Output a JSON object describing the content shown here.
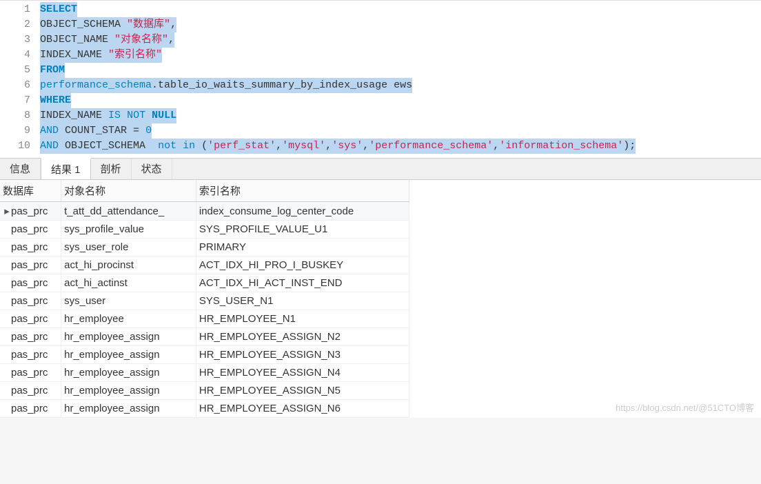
{
  "editor": {
    "lines": [
      1,
      2,
      3,
      4,
      5,
      6,
      7,
      8,
      9,
      10
    ],
    "line1": {
      "select": "SELECT"
    },
    "line2": {
      "obj_schema": "OBJECT_SCHEMA",
      "alias": "\"数据库\"",
      "comma": ","
    },
    "line3": {
      "obj_name": "OBJECT_NAME",
      "alias": "\"对象名称\"",
      "comma": ","
    },
    "line4": {
      "idx_name": "INDEX_NAME",
      "alias": "\"索引名称\""
    },
    "line5": {
      "from": "FROM"
    },
    "line6": {
      "schema": "performance_schema",
      "dot": ".",
      "table": "table_io_waits_summary_by_index_usage",
      "sp": " ",
      "alias": "ews"
    },
    "line7": {
      "where": "WHERE"
    },
    "line8": {
      "idx_name": "INDEX_NAME",
      "is": "IS",
      "not": "NOT",
      "null": "NULL"
    },
    "line9": {
      "and": "AND",
      "count_star": "COUNT_STAR",
      "eq": " = ",
      "zero": "0"
    },
    "line10": {
      "and": "AND",
      "obj_schema": "OBJECT_SCHEMA",
      "not_in": "not in",
      "paren_o": " (",
      "s1": "'perf_stat'",
      "c": ",",
      "s2": "'mysql'",
      "s3": "'sys'",
      "s4": "'performance_schema'",
      "s5": "'information_schema'",
      "paren_c": ");"
    }
  },
  "tabs": {
    "info": "信息",
    "result1": "结果 1",
    "analyze": "剖析",
    "status": "状态"
  },
  "columns": {
    "db": "数据库",
    "obj": "对象名称",
    "idx": "索引名称"
  },
  "rows": [
    {
      "db": "pas_prc",
      "obj": "t_att_dd_attendance_",
      "idx": "index_consume_log_center_code",
      "selected": true
    },
    {
      "db": "pas_prc",
      "obj": "sys_profile_value",
      "idx": "SYS_PROFILE_VALUE_U1"
    },
    {
      "db": "pas_prc",
      "obj": "sys_user_role",
      "idx": "PRIMARY"
    },
    {
      "db": "pas_prc",
      "obj": "act_hi_procinst",
      "idx": "ACT_IDX_HI_PRO_I_BUSKEY"
    },
    {
      "db": "pas_prc",
      "obj": "act_hi_actinst",
      "idx": "ACT_IDX_HI_ACT_INST_END"
    },
    {
      "db": "pas_prc",
      "obj": "sys_user",
      "idx": "SYS_USER_N1"
    },
    {
      "db": "pas_prc",
      "obj": "hr_employee",
      "idx": "HR_EMPLOYEE_N1"
    },
    {
      "db": "pas_prc",
      "obj": "hr_employee_assign",
      "idx": "HR_EMPLOYEE_ASSIGN_N2"
    },
    {
      "db": "pas_prc",
      "obj": "hr_employee_assign",
      "idx": "HR_EMPLOYEE_ASSIGN_N3"
    },
    {
      "db": "pas_prc",
      "obj": "hr_employee_assign",
      "idx": "HR_EMPLOYEE_ASSIGN_N4"
    },
    {
      "db": "pas_prc",
      "obj": "hr_employee_assign",
      "idx": "HR_EMPLOYEE_ASSIGN_N5"
    },
    {
      "db": "pas_prc",
      "obj": "hr_employee_assign",
      "idx": "HR_EMPLOYEE_ASSIGN_N6"
    }
  ],
  "watermark": "https://blog.csdn.net/@51CTO博客"
}
